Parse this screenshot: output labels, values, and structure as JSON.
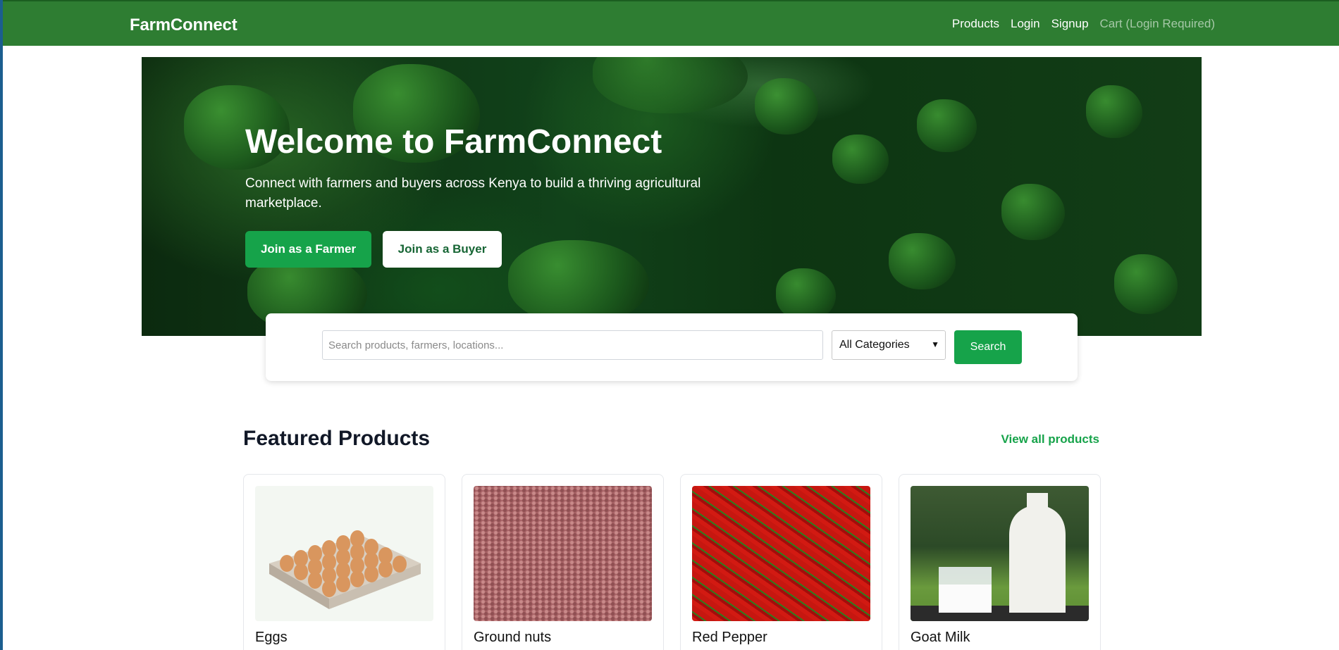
{
  "nav": {
    "brand": "FarmConnect",
    "links": [
      "Products",
      "Login",
      "Signup"
    ],
    "cart": "Cart (Login Required)"
  },
  "hero": {
    "title": "Welcome to FarmConnect",
    "subtitle": "Connect with farmers and buyers across Kenya to build a thriving agricultural marketplace.",
    "farmer_button": "Join as a Farmer",
    "buyer_button": "Join as a Buyer"
  },
  "search": {
    "placeholder": "Search products, farmers, locations...",
    "category": "All Categories",
    "button": "Search"
  },
  "featured": {
    "title": "Featured Products",
    "view_all": "View all products",
    "products": [
      {
        "name": "Eggs"
      },
      {
        "name": "Ground nuts"
      },
      {
        "name": "Red Pepper"
      },
      {
        "name": "Goat Milk"
      }
    ]
  },
  "colors": {
    "nav_bg": "#2e7d32",
    "accent": "#16a34a"
  }
}
